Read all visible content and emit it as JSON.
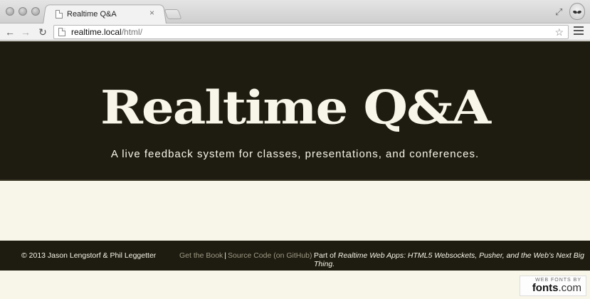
{
  "browser": {
    "tab_title": "Realtime Q&A",
    "tab_close": "×",
    "url_host": "realtime.local",
    "url_path": "/html/",
    "icons": {
      "back": "back-arrow-icon",
      "forward": "forward-arrow-icon",
      "reload": "reload-icon",
      "star": "star-icon",
      "menu": "menu-icon",
      "fullscreen": "fullscreen-icon"
    },
    "back_glyph": "←",
    "forward_glyph": "→",
    "reload_glyph": "↻",
    "star_glyph": "☆",
    "fullscreen_glyph": "⤢"
  },
  "hero": {
    "logo": "Realtime Q&A",
    "tagline": "A live feedback system for classes, presentations, and conferences."
  },
  "footer": {
    "copyright": "© 2013 Jason Lengstorf & Phil Leggetter",
    "link_book": "Get the Book",
    "separator": "|",
    "link_source": "Source Code (on GitHub)",
    "part_of_prefix": "Part of ",
    "part_of_title": "Realtime Web Apps: HTML5 Websockets, Pusher, and the Web’s Next Big Thing."
  },
  "badge": {
    "top": "WEB FONTS BY",
    "logo_main": "fonts",
    "logo_suffix": ".com"
  },
  "colors": {
    "dark": "#1e1b10",
    "cream": "#f8f6e9",
    "link_muted": "#9f9b86"
  }
}
